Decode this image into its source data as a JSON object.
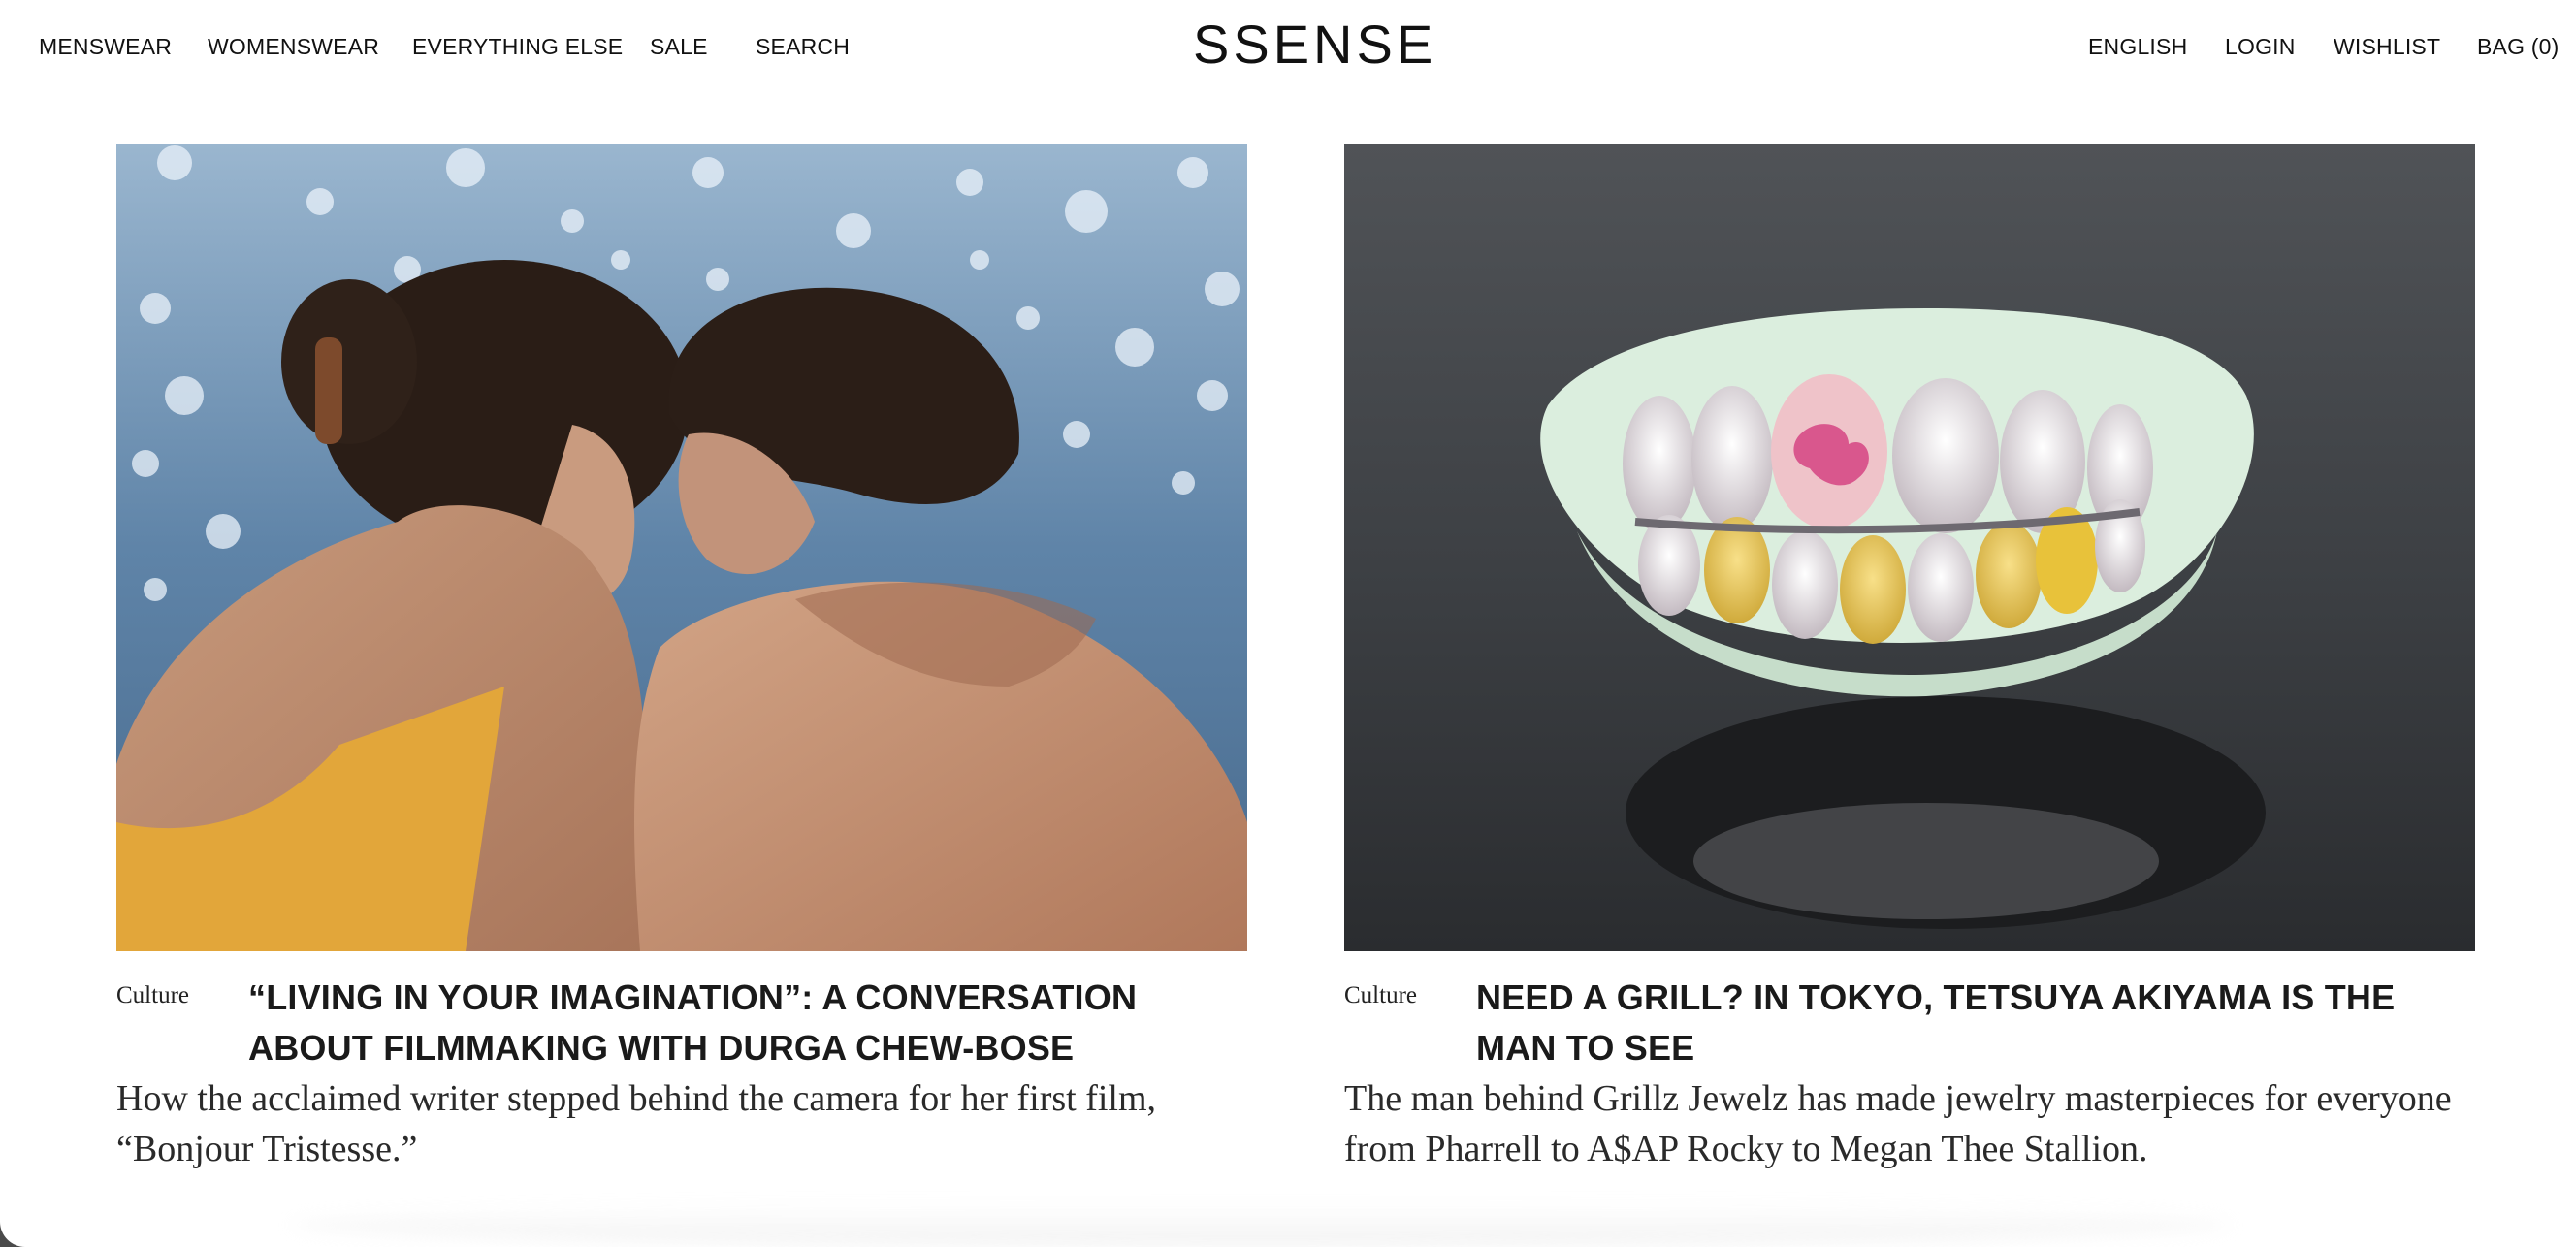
{
  "header": {
    "left_links": [
      "MENSWEAR",
      "WOMENSWEAR",
      "EVERYTHING ELSE",
      "SALE",
      "SEARCH"
    ],
    "logo": "SSENSE",
    "right_links": [
      "ENGLISH",
      "LOGIN",
      "WISHLIST",
      "BAG (0)"
    ]
  },
  "articles": [
    {
      "category": "Culture",
      "headline": "“LIVING IN YOUR IMAGINATION”: A CONVERSATION ABOUT FILMMAKING WITH DURGA CHEW-BOSE",
      "dek": "How the acclaimed writer stepped behind the camera for her first film, “Bonjour Tristesse.”"
    },
    {
      "category": "Culture",
      "headline": "NEED A GRILL? IN TOKYO, TETSUYA AKIYAMA IS THE MAN TO SEE",
      "dek": "The man behind Grillz Jewelz has made jewelry masterpieces for everyone from Pharrell to A$AP Rocky to Megan Thee Stallion."
    }
  ],
  "colors": {
    "text": "#111111",
    "background": "#ffffff",
    "window_chrome": "#4a4a4a"
  }
}
